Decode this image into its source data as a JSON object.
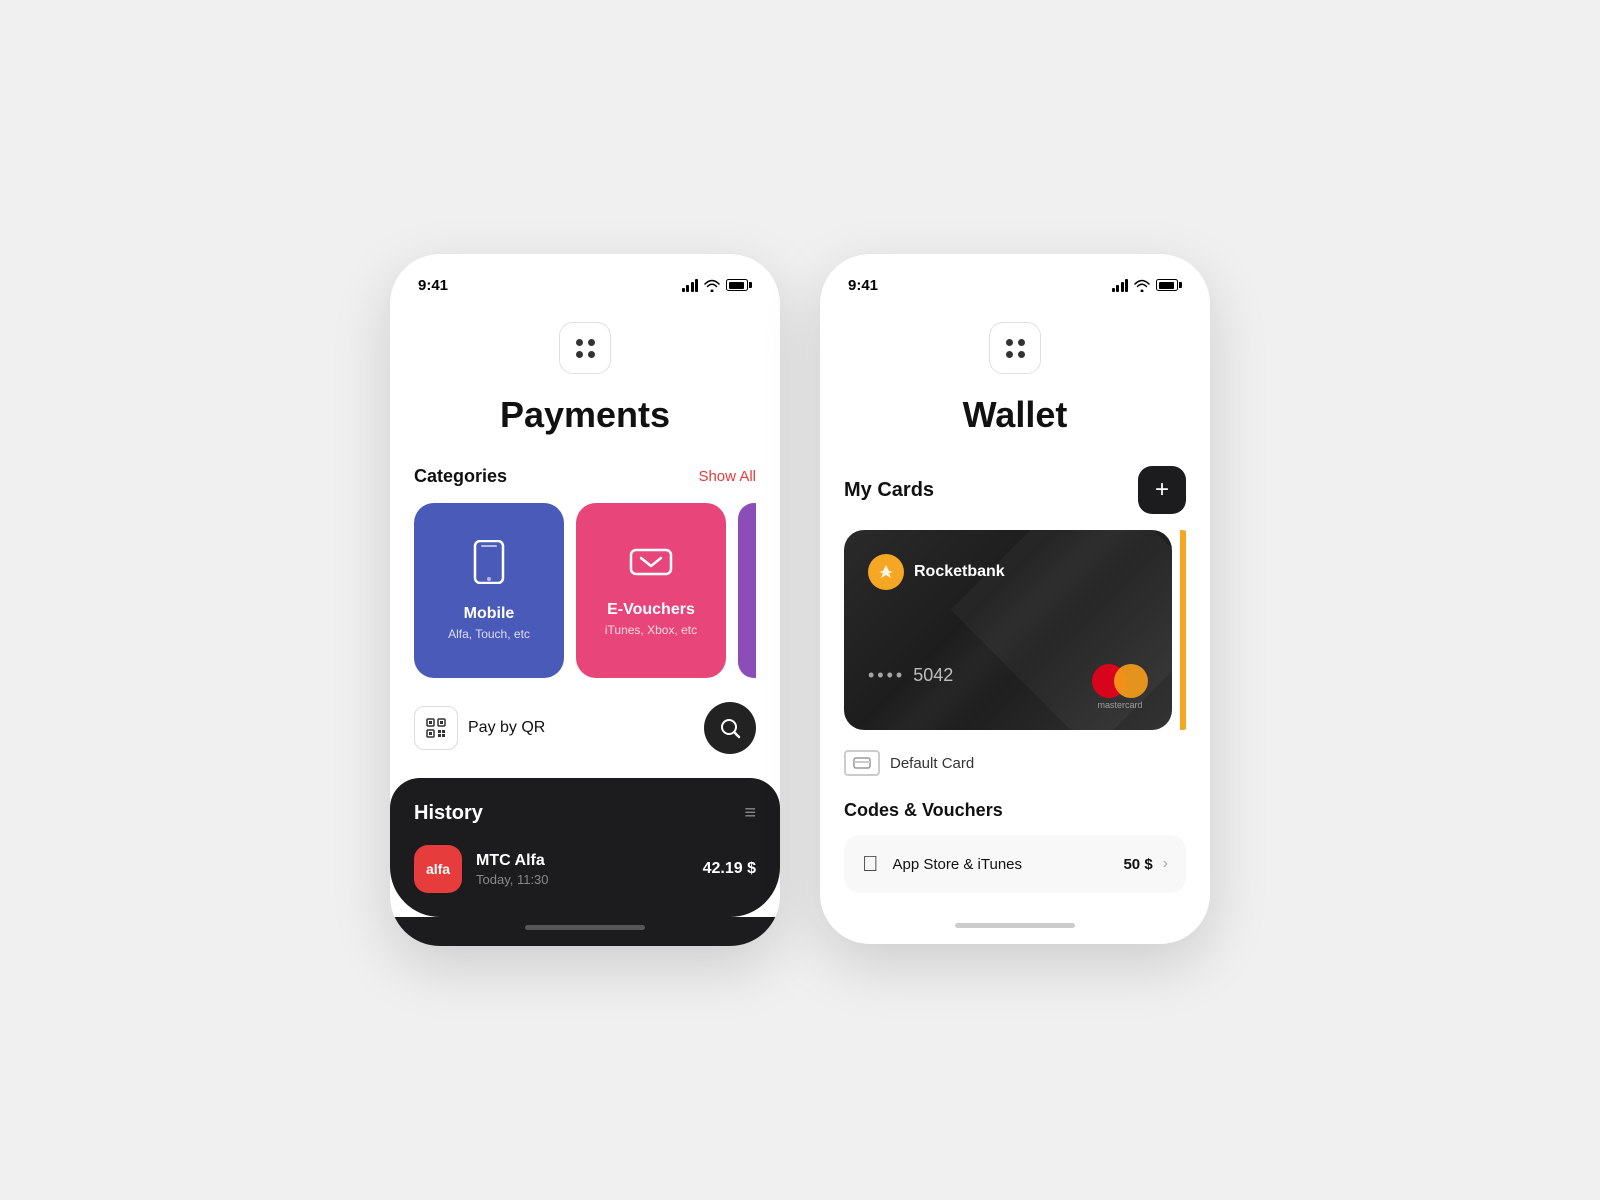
{
  "background": "#f0f0f0",
  "payments_screen": {
    "status_bar": {
      "time": "9:41"
    },
    "page_title": "Payments",
    "categories_section": {
      "title": "Categories",
      "show_all_label": "Show All",
      "items": [
        {
          "id": "mobile",
          "name": "Mobile",
          "sub": "Alfa, Touch, etc",
          "color": "#4a5ab9"
        },
        {
          "id": "evouchers",
          "name": "E-Vouchers",
          "sub": "iTunes, Xbox, etc",
          "color": "#e8457a"
        }
      ]
    },
    "pay_qr_label": "Pay by QR",
    "history_section": {
      "title": "History",
      "item": {
        "logo_text": "alfa",
        "name": "MTC Alfa",
        "date": "Today, 11:30",
        "amount": "42.19 $"
      }
    }
  },
  "wallet_screen": {
    "status_bar": {
      "time": "9:41"
    },
    "page_title": "Wallet",
    "my_cards": {
      "title": "My Cards",
      "add_btn_label": "+",
      "card": {
        "bank_name": "Rocketbank",
        "number_dots": "••••",
        "last4": "5042",
        "mc_label": "mastercard"
      },
      "default_card_label": "Default Card"
    },
    "codes_vouchers": {
      "title": "Codes & Vouchers",
      "items": [
        {
          "name": "App Store & iTunes",
          "amount": "50 $"
        }
      ]
    }
  }
}
